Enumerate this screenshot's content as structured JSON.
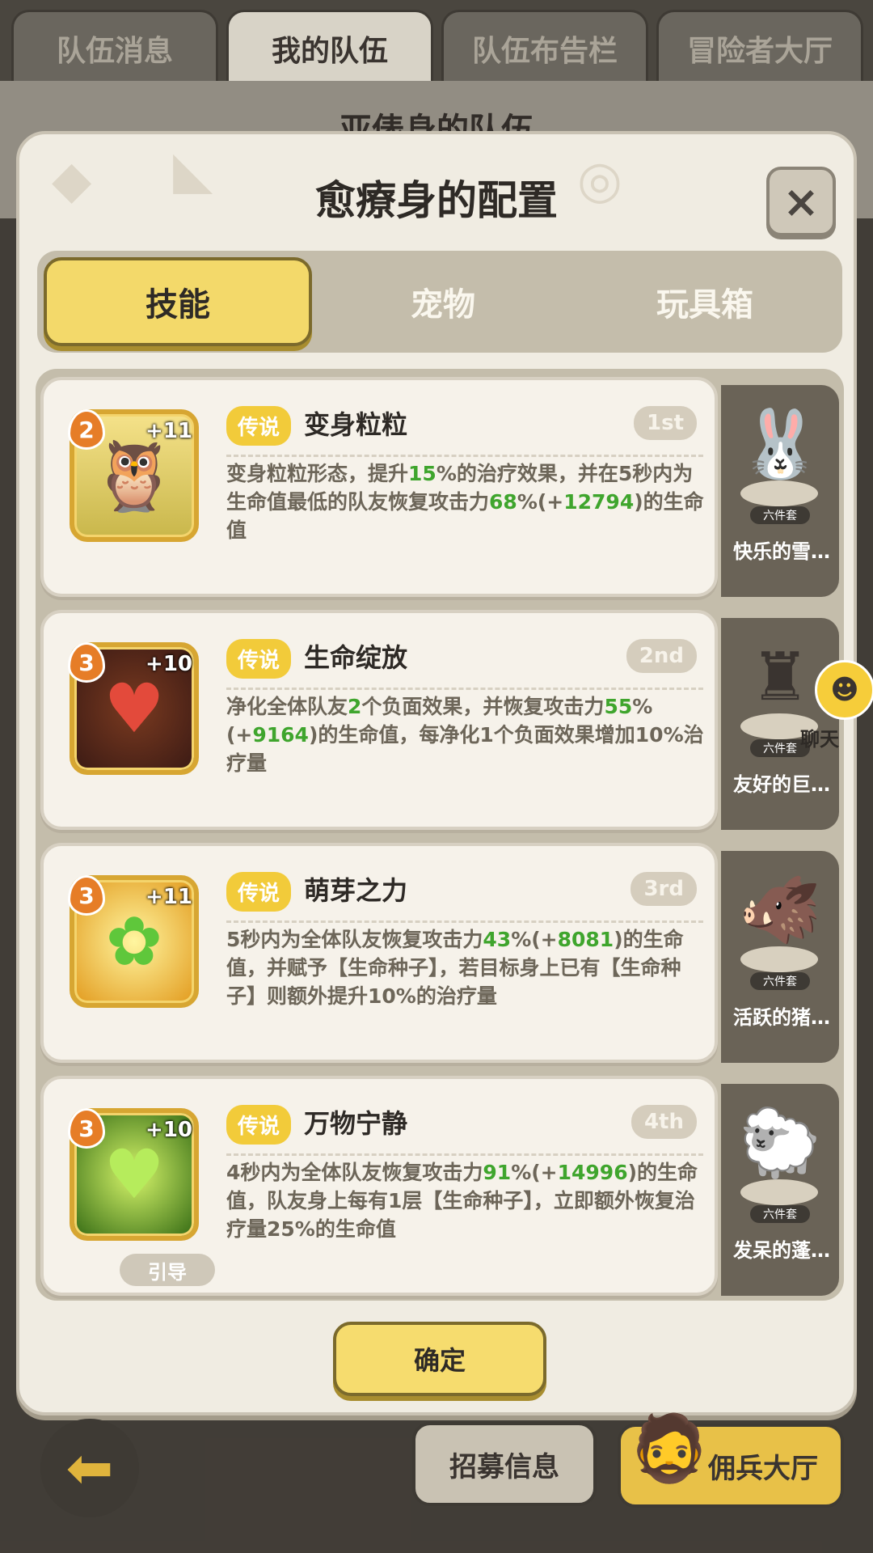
{
  "top_tabs": [
    "队伍消息",
    "我的队伍",
    "队伍布告栏",
    "冒险者大厅"
  ],
  "background_title": "亚俵身的队伍",
  "modal": {
    "title": "愈療身的配置",
    "close_label": "×",
    "segments": [
      "技能",
      "宠物",
      "玩具箱"
    ],
    "active_segment": "技能",
    "confirm_label": "确定"
  },
  "skills": [
    {
      "level": "2",
      "plus": "+11",
      "rarity": "传说",
      "name": "变身粒粒",
      "rank": "1st",
      "desc": [
        {
          "t": "变身粒粒形态，提升"
        },
        {
          "t": "15",
          "g": true
        },
        {
          "t": "%的治疗效果，并在5秒内为生命值最低的队友恢复攻击力"
        },
        {
          "t": "68",
          "g": true
        },
        {
          "t": "%(+"
        },
        {
          "t": "12794",
          "g": true
        },
        {
          "t": ")的生命值"
        }
      ],
      "icon": "owl-icon",
      "pet_name": "快乐的雪…",
      "pet_set": "六件套",
      "pet_icon": "snow-bunny-icon"
    },
    {
      "level": "3",
      "plus": "+10",
      "rarity": "传说",
      "name": "生命绽放",
      "rank": "2nd",
      "desc": [
        {
          "t": "净化全体队友"
        },
        {
          "t": "2",
          "g": true
        },
        {
          "t": "个负面效果，并恢复攻击力"
        },
        {
          "t": "55",
          "g": true
        },
        {
          "t": "%(+"
        },
        {
          "t": "9164",
          "g": true
        },
        {
          "t": ")的生命值，每净化1个负面效果增加10%治疗量"
        }
      ],
      "icon": "heart-flower-icon",
      "pet_name": "友好的巨…",
      "pet_set": "六件套",
      "pet_icon": "giant-icon"
    },
    {
      "level": "3",
      "plus": "+11",
      "rarity": "传说",
      "name": "萌芽之力",
      "rank": "3rd",
      "desc": [
        {
          "t": "5秒内为全体队友恢复攻击力"
        },
        {
          "t": "43",
          "g": true
        },
        {
          "t": "%(+"
        },
        {
          "t": "8081",
          "g": true
        },
        {
          "t": ")的生命值，并赋予【生命种子】，若目标身上已有【生命种子】则额外提升10%的治疗量"
        }
      ],
      "icon": "sprout-icon",
      "pet_name": "活跃的猪…",
      "pet_set": "六件套",
      "pet_icon": "boar-icon"
    },
    {
      "level": "3",
      "plus": "+10",
      "rarity": "传说",
      "name": "万物宁静",
      "rank": "4th",
      "desc": [
        {
          "t": "4秒内为全体队友恢复攻击力"
        },
        {
          "t": "91",
          "g": true
        },
        {
          "t": "%(+"
        },
        {
          "t": "14996",
          "g": true
        },
        {
          "t": ")的生命值，队友身上每有1层【生命种子】，立即额外恢复治疗量25%的生命值"
        }
      ],
      "icon": "green-heart-icon",
      "pet_name": "发呆的蓬…",
      "pet_set": "六件套",
      "pet_icon": "fluffy-pet-icon",
      "guide_label": "引导"
    }
  ],
  "chat_label": "聊天",
  "bottom": {
    "recruit_label": "招募信息",
    "mercenary_label": "佣兵大厅"
  },
  "colors": {
    "accent": "#f3d96a",
    "highlight_green": "#3fa52d",
    "rarity_badge": "#f2cb3a"
  }
}
